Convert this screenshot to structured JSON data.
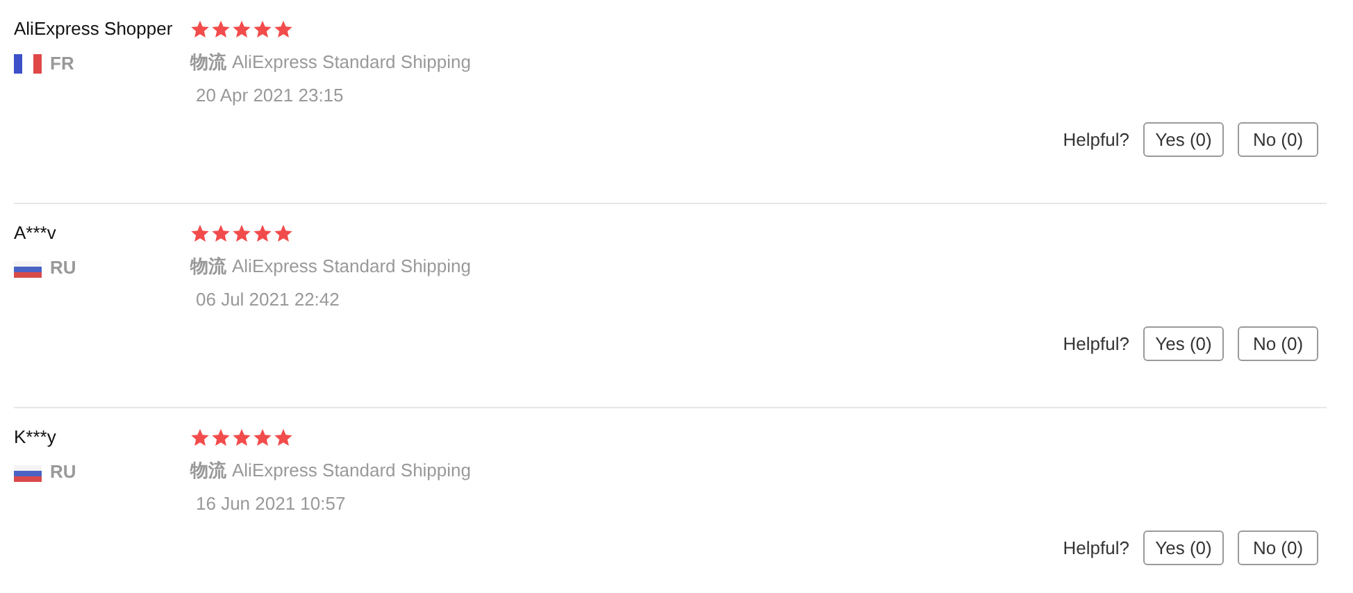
{
  "reviews": [
    {
      "name": "AliExpress Shopper",
      "kind": "fr",
      "country": "FR",
      "stars": 5,
      "shipping_label": "物流",
      "shipping": "AliExpress Standard Shipping",
      "date": "20 Apr 2021 23:15",
      "helpful_label": "Helpful?",
      "yes": "Yes (0)",
      "no": "No (0)"
    },
    {
      "name": "A***v",
      "kind": "ru",
      "country": "RU",
      "stars": 5,
      "shipping_label": "物流",
      "shipping": "AliExpress Standard Shipping",
      "date": "06 Jul 2021 22:42",
      "helpful_label": "Helpful?",
      "yes": "Yes (0)",
      "no": "No (0)"
    },
    {
      "name": "K***y",
      "kind": "ru",
      "country": "RU",
      "stars": 5,
      "shipping_label": "物流",
      "shipping": "AliExpress Standard Shipping",
      "date": "16 Jun 2021 10:57",
      "helpful_label": "Helpful?",
      "yes": "Yes (0)",
      "no": "No (0)"
    }
  ]
}
